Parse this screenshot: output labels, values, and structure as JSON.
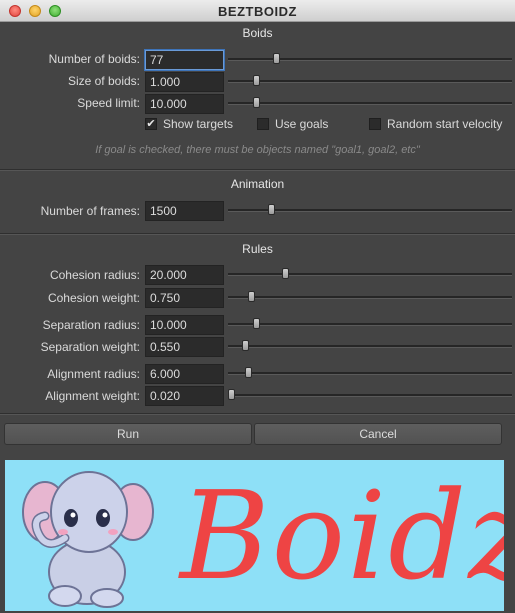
{
  "window": {
    "title": "BEZTBOIDZ"
  },
  "sections": {
    "boids": "Boids",
    "animation": "Animation",
    "rules": "Rules"
  },
  "boids": {
    "number": {
      "label": "Number of boids:",
      "value": "77",
      "slider": 0.17
    },
    "size": {
      "label": "Size of boids:",
      "value": "1.000",
      "slider": 0.1
    },
    "speed": {
      "label": "Speed limit:",
      "value": "10.000",
      "slider": 0.1
    }
  },
  "checkboxes": {
    "show_targets": {
      "label": "Show targets",
      "checked": true
    },
    "use_goals": {
      "label": "Use goals",
      "checked": false
    },
    "random_start": {
      "label": "Random start velocity",
      "checked": false
    }
  },
  "hint": "If goal is checked, there must be objects named \"goal1, goal2, etc\"",
  "animation": {
    "frames": {
      "label": "Number of frames:",
      "value": "1500",
      "slider": 0.15
    }
  },
  "rules": {
    "cohesion_radius": {
      "label": "Cohesion radius:",
      "value": "20.000",
      "slider": 0.2
    },
    "cohesion_weight": {
      "label": "Cohesion weight:",
      "value": "0.750",
      "slider": 0.08
    },
    "separation_radius": {
      "label": "Separation radius:",
      "value": "10.000",
      "slider": 0.1
    },
    "separation_weight": {
      "label": "Separation weight:",
      "value": "0.550",
      "slider": 0.06
    },
    "alignment_radius": {
      "label": "Alignment radius:",
      "value": "6.000",
      "slider": 0.07
    },
    "alignment_weight": {
      "label": "Alignment weight:",
      "value": "0.020",
      "slider": 0.01
    }
  },
  "buttons": {
    "run": "Run",
    "cancel": "Cancel"
  },
  "banner": {
    "text": "Boidz",
    "text_color": "#ee4444",
    "background": "#8ee0f7"
  }
}
